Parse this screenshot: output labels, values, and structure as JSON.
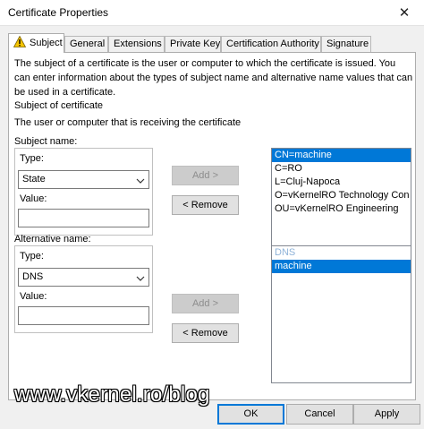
{
  "window": {
    "title": "Certificate Properties",
    "close_glyph": "✕"
  },
  "tabs": [
    {
      "label": "Subject",
      "icon": "warning-icon"
    },
    {
      "label": "General"
    },
    {
      "label": "Extensions"
    },
    {
      "label": "Private Key"
    },
    {
      "label": "Certification Authority"
    },
    {
      "label": "Signature"
    }
  ],
  "subject": {
    "description": "The subject of a certificate is the user or computer to which the certificate is issued. You can enter information about the types of subject name and alternative name values that can be used in a certificate.",
    "section_title": "Subject of certificate",
    "section_desc": "The user or computer that is receiving the certificate",
    "subject_name": {
      "label": "Subject name:",
      "type_label": "Type:",
      "type_value": "State",
      "value_label": "Value:",
      "value": ""
    },
    "alt_name": {
      "label": "Alternative name:",
      "type_label": "Type:",
      "type_value": "DNS",
      "value_label": "Value:",
      "value": ""
    },
    "buttons": {
      "add": "Add >",
      "remove": "< Remove"
    },
    "subject_list": [
      {
        "text": "CN=machine",
        "selected": true
      },
      {
        "text": "C=RO",
        "selected": false
      },
      {
        "text": "L=Cluj-Napoca",
        "selected": false
      },
      {
        "text": "O=vKernelRO Technology Con",
        "selected": false
      },
      {
        "text": "OU=vKernelRO Engineering",
        "selected": false
      }
    ],
    "alt_list": [
      {
        "text": "DNS",
        "header": true
      },
      {
        "text": "machine",
        "selected": true
      }
    ]
  },
  "footer": {
    "ok": "OK",
    "cancel": "Cancel",
    "apply": "Apply"
  },
  "watermark": "www.vkernel.ro/blog",
  "colors": {
    "accent": "#0078d7",
    "warning": "#f5c400"
  }
}
